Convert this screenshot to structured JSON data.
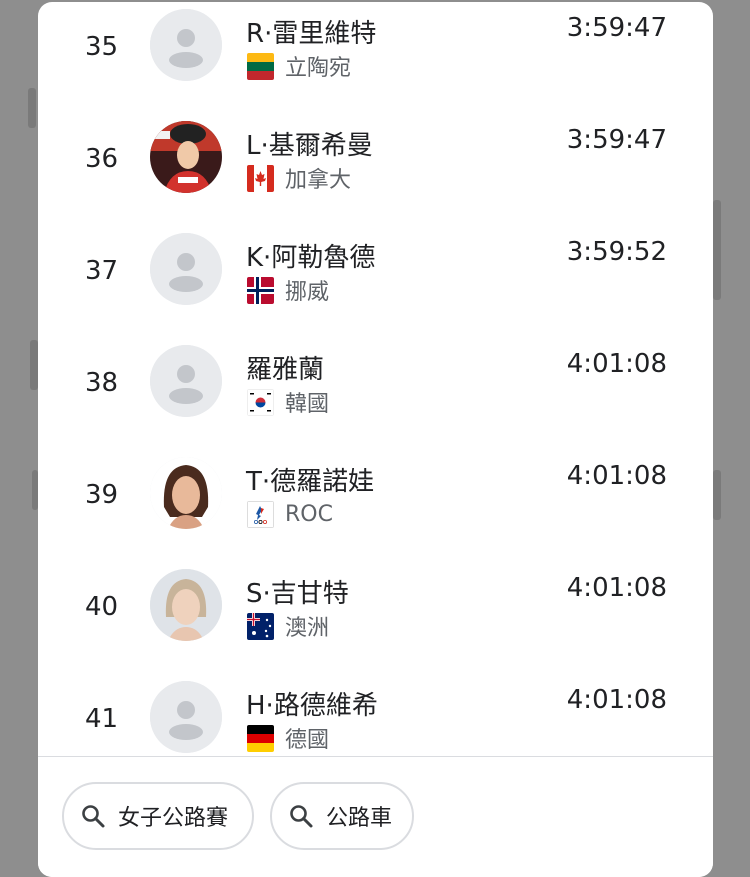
{
  "results": [
    {
      "rank": "35",
      "name": "R·雷里維特",
      "country": "立陶宛",
      "time": "3:59:47",
      "flag": "lithuania-flag",
      "avatar": "placeholder"
    },
    {
      "rank": "36",
      "name": "L·基爾希曼",
      "country": "加拿大",
      "time": "3:59:47",
      "flag": "canada-flag",
      "avatar": "photo"
    },
    {
      "rank": "37",
      "name": "K·阿勒魯德",
      "country": "挪威",
      "time": "3:59:52",
      "flag": "norway-flag",
      "avatar": "placeholder"
    },
    {
      "rank": "38",
      "name": "羅雅蘭",
      "country": "韓國",
      "time": "4:01:08",
      "flag": "korea-flag",
      "avatar": "placeholder"
    },
    {
      "rank": "39",
      "name": "T·德羅諾娃",
      "country": "ROC",
      "time": "4:01:08",
      "flag": "roc-flag",
      "avatar": "photo"
    },
    {
      "rank": "40",
      "name": "S·吉甘特",
      "country": "澳洲",
      "time": "4:01:08",
      "flag": "australia-flag",
      "avatar": "photo"
    },
    {
      "rank": "41",
      "name": "H·路德維希",
      "country": "德國",
      "time": "4:01:08",
      "flag": "germany-flag",
      "avatar": "placeholder"
    }
  ],
  "chips": [
    {
      "label": "女子公路賽",
      "icon": "search-icon"
    },
    {
      "label": "公路車",
      "icon": "search-icon"
    }
  ]
}
